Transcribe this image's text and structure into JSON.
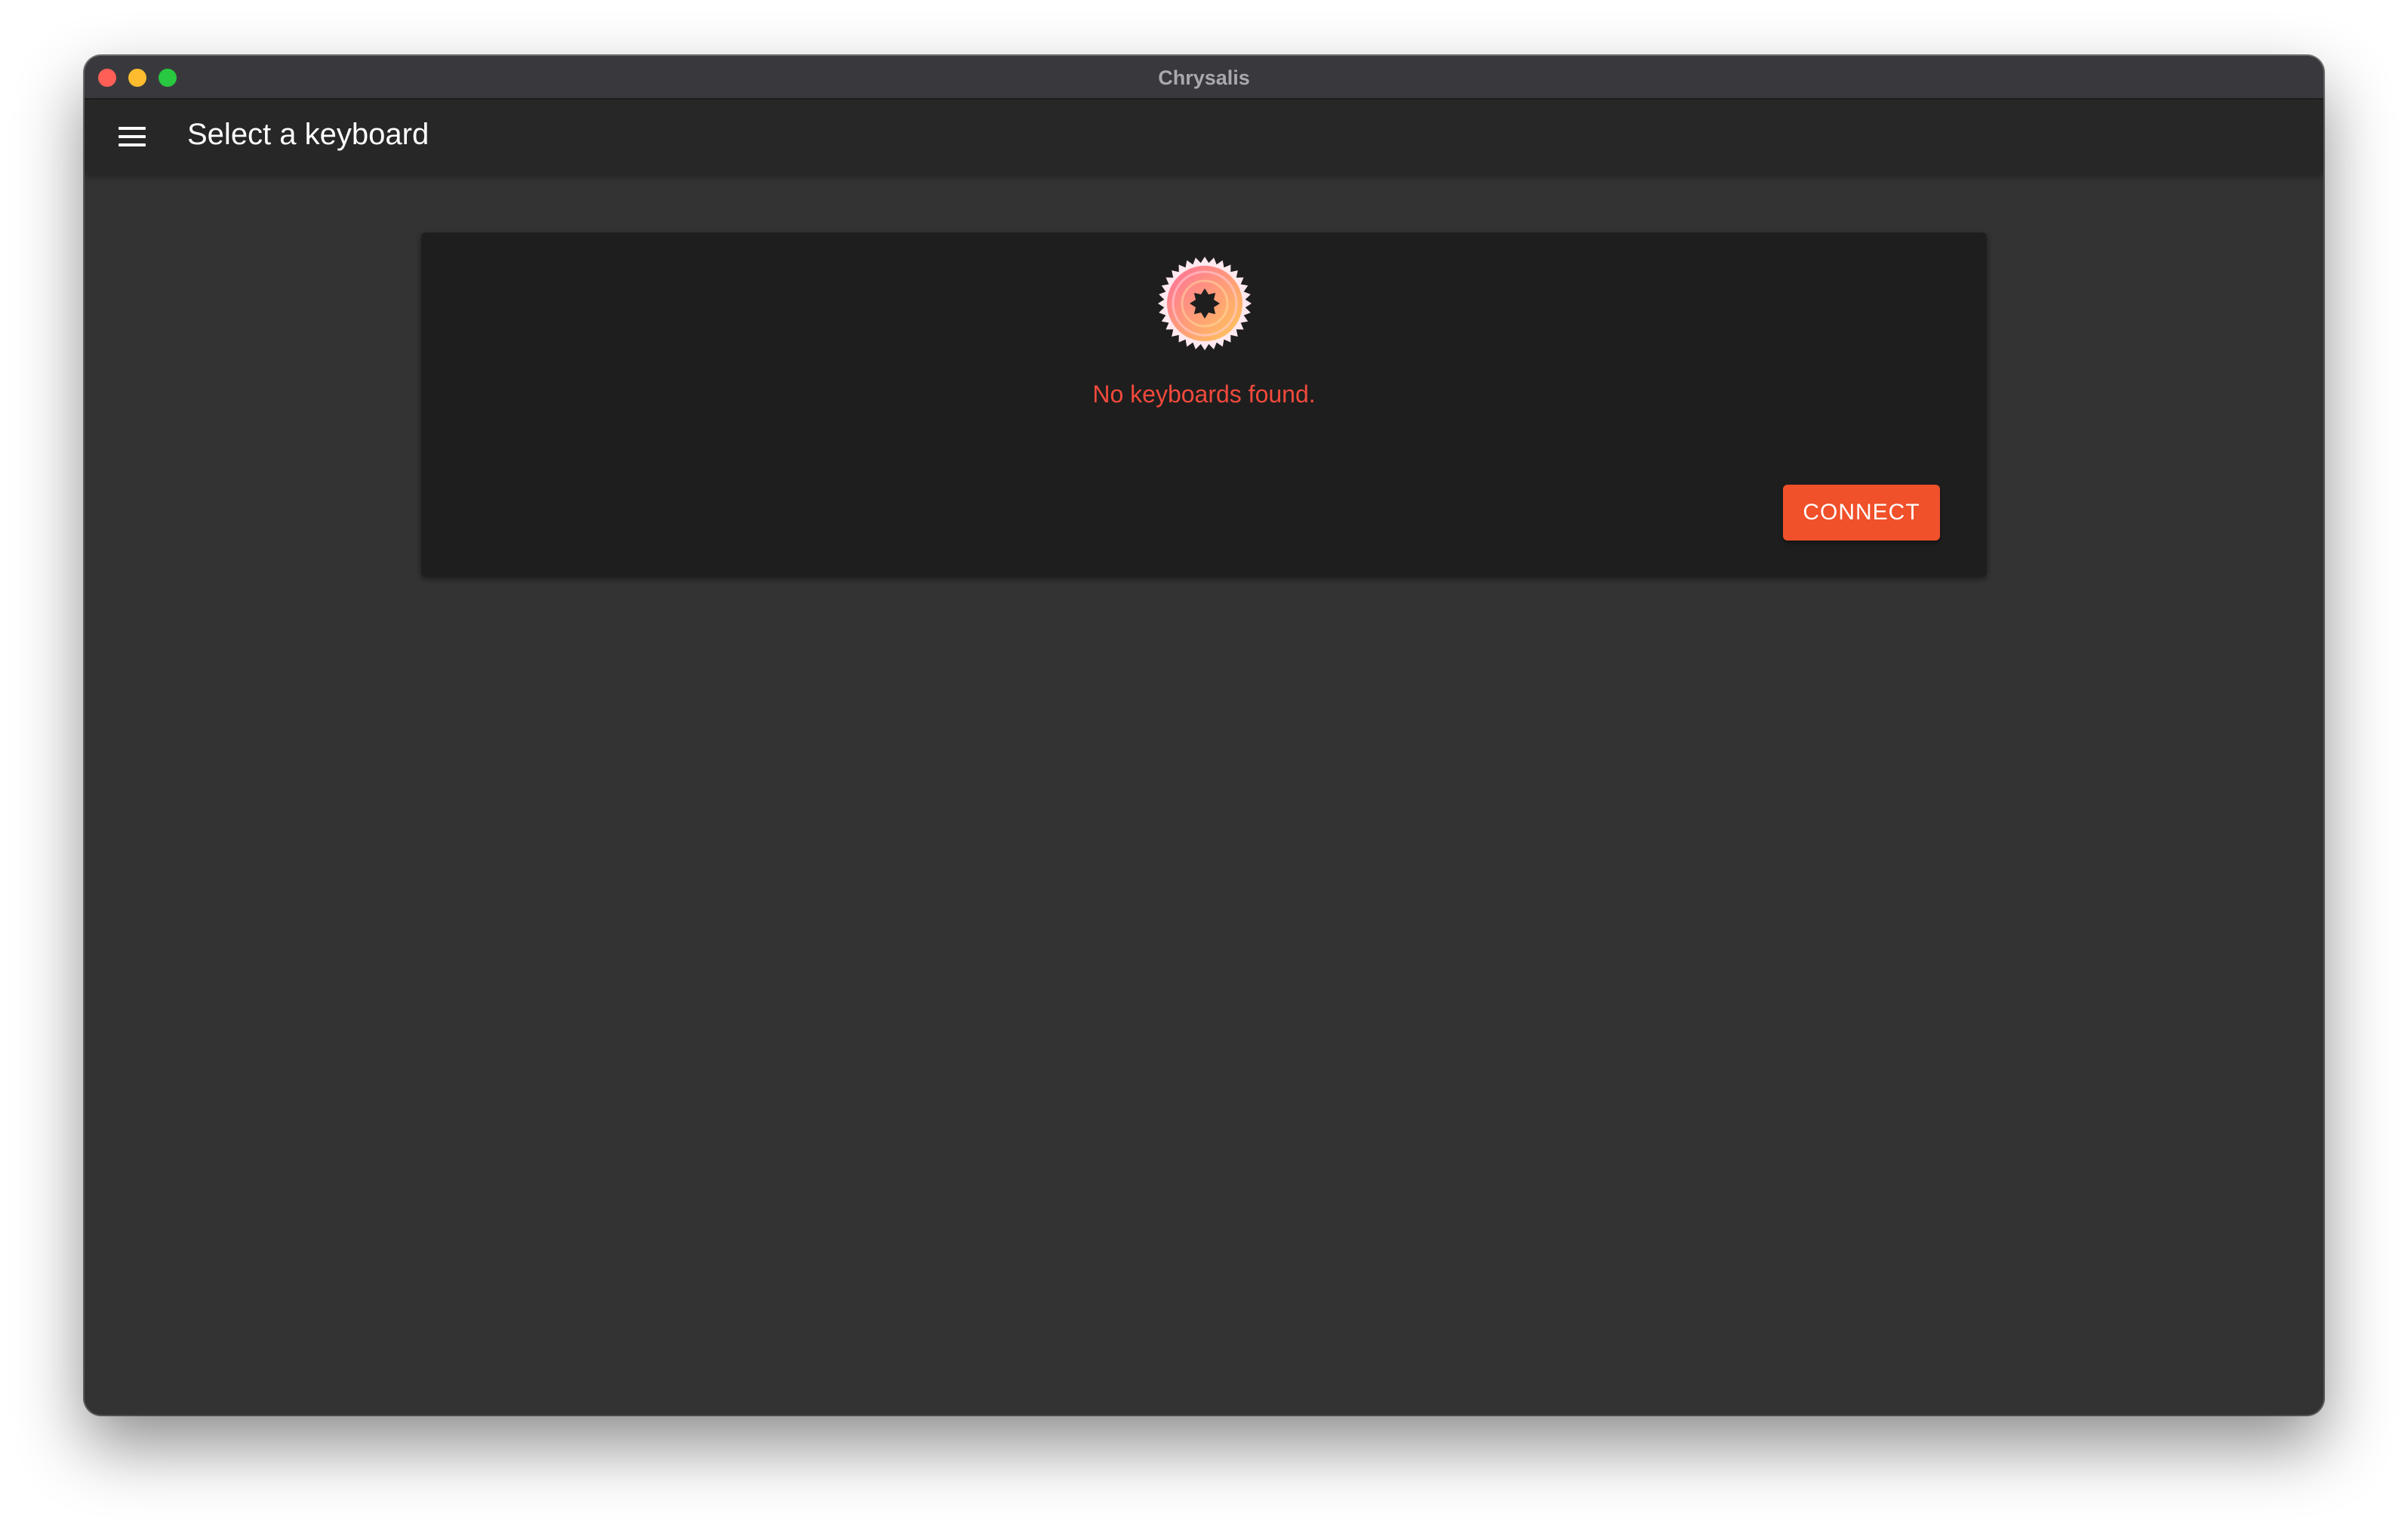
{
  "window": {
    "title": "Chrysalis"
  },
  "appbar": {
    "title": "Select a keyboard",
    "menu_icon": "hamburger-menu-icon"
  },
  "card": {
    "logo": "chrysalis-logo",
    "message": "No keyboards found.",
    "connect_label": "CONNECT"
  },
  "colors": {
    "accent": "#f0502a",
    "error_text": "#f24a3c",
    "background": "#333333",
    "card": "#1e1e1e",
    "appbar": "#272727"
  }
}
